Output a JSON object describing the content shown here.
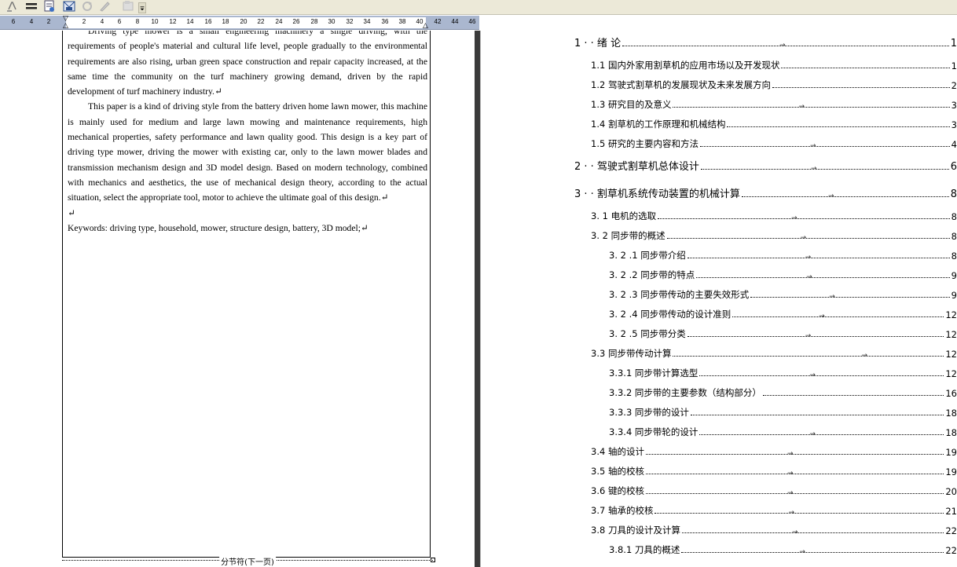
{
  "toolbar": {
    "icons": [
      "text-direction-icon",
      "lines-icon",
      "mail-merge-icon",
      "envelope-icon",
      "redo-icon",
      "pencil-icon",
      "insert-icon",
      "toolbar-options-icon"
    ]
  },
  "ruler": {
    "labels": [
      "6",
      "4",
      "2",
      "2",
      "4",
      "6",
      "8",
      "10",
      "12",
      "14",
      "16",
      "18",
      "20",
      "22",
      "24",
      "26",
      "28",
      "30",
      "32",
      "34",
      "36",
      "38",
      "40",
      "42",
      "44",
      "46"
    ]
  },
  "document_left": {
    "paragraphs": [
      "Driving type mower is a small engineering machinery a single driving, with the requirements of people's material and cultural life level, people gradually to the environmental requirements are also rising, urban green space construction and repair capacity increased, at the same time the community on the turf machinery growing demand, driven by the rapid development of turf machinery industry.↵",
      "This paper is a kind of driving style from the battery driven home lawn mower, this machine is mainly used for medium and large lawn mowing and maintenance requirements, high mechanical properties, safety performance and lawn quality good. This design is a key part of driving type mower, driving the mower with existing car, only to the lawn mower blades and transmission mechanism design and 3D model design. Based on modern technology, combined with mechanics and aesthetics, the use of mechanical design theory, according to the actual situation, select the appropriate tool, motor to achieve the ultimate goal of this design.↵",
      "↵",
      "Keywords: driving type, household, mower, structure design, battery, 3D model;↵"
    ],
    "section_break": "分节符(下一页)"
  },
  "toc": [
    {
      "level": 1,
      "title": "1 · · 绪  论",
      "page": "1"
    },
    {
      "level": 2,
      "title": "1.1 国内外家用割草机的应用市场以及开发现状",
      "page": "1"
    },
    {
      "level": 2,
      "title": "1.2 驾驶式割草机的发展现状及未来发展方向",
      "page": "2"
    },
    {
      "level": 2,
      "title": "1.3 研究目的及意义",
      "page": "3"
    },
    {
      "level": 2,
      "title": "1.4 割草机的工作原理和机械结构",
      "page": "3"
    },
    {
      "level": 2,
      "title": "1.5 研究的主要内容和方法",
      "page": "4"
    },
    {
      "level": 1,
      "title": "2 · · 驾驶式割草机总体设计",
      "page": "6"
    },
    {
      "level": 1,
      "title": "3 · · 割草机系统传动装置的机械计算",
      "page": "8"
    },
    {
      "level": 2,
      "title": "3. 1 电机的选取",
      "page": "8"
    },
    {
      "level": 2,
      "title": "3. 2 同步带的概述",
      "page": "8"
    },
    {
      "level": 3,
      "title": "3. 2 .1 同步带介绍",
      "page": "8"
    },
    {
      "level": 3,
      "title": "3. 2 .2 同步带的特点",
      "page": "9"
    },
    {
      "level": 3,
      "title": "3. 2 .3 同步带传动的主要失效形式",
      "page": "9"
    },
    {
      "level": 3,
      "title": "3. 2 .4 同步带传动的设计准则",
      "page": "12"
    },
    {
      "level": 3,
      "title": "3. 2 .5 同步带分类",
      "page": "12"
    },
    {
      "level": 2,
      "title": "3.3 同步带传动计算",
      "page": "12"
    },
    {
      "level": 3,
      "title": "3.3.1 同步带计算选型",
      "page": "12"
    },
    {
      "level": 3,
      "title": "3.3.2 同步带的主要参数（结构部分）",
      "page": "16"
    },
    {
      "level": 3,
      "title": "3.3.3 同步带的设计",
      "page": "18"
    },
    {
      "level": 3,
      "title": "3.3.4 同步带轮的设计",
      "page": "18"
    },
    {
      "level": 2,
      "title": "3.4 轴的设计",
      "page": "19"
    },
    {
      "level": 2,
      "title": "3.5 轴的校核",
      "page": "19"
    },
    {
      "level": 2,
      "title": "3.6 键的校核",
      "page": "20"
    },
    {
      "level": 2,
      "title": "3.7 轴承的校核",
      "page": "21"
    },
    {
      "level": 2,
      "title": "3.8 刀具的设计及计算",
      "page": "22"
    },
    {
      "level": 3,
      "title": "3.8.1 刀具的概述",
      "page": "22"
    }
  ]
}
